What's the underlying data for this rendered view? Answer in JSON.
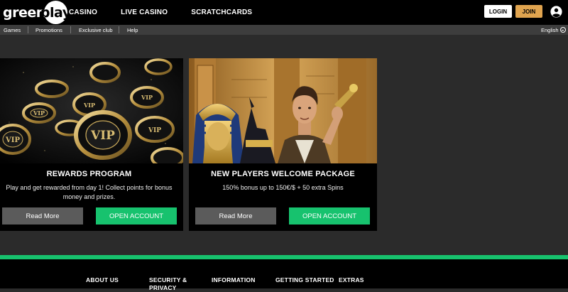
{
  "header": {
    "logo": {
      "text": "green",
      "circle_text": "play"
    },
    "nav": [
      "CASINO",
      "LIVE CASINO",
      "SCRATCHCARDS"
    ],
    "login_label": "LOGIN",
    "join_label": "JOIN",
    "join_color": "#e0a44f"
  },
  "subnav": {
    "items": [
      "Games",
      "Promotions",
      "Exclusive club",
      "Help"
    ],
    "language": "English"
  },
  "cards": [
    {
      "image": "vip-poker-chips",
      "title": "REWARDS PROGRAM",
      "description": "Play and get rewarded from day 1! Collect points for bonus money and prizes.",
      "read_more": "Read More",
      "open_account": "OPEN ACCOUNT"
    },
    {
      "image": "egyptian-adventurer-slot",
      "title": "NEW PLAYERS WELCOME PACKAGE",
      "description": "150% bonus up to 150€/$ + 50 extra Spins",
      "read_more": "Read More",
      "open_account": "OPEN ACCOUNT"
    }
  ],
  "footer": {
    "links": [
      "ABOUT US",
      "SECURITY & PRIVACY",
      "INFORMATION",
      "GETTING STARTED",
      "EXTRAS"
    ]
  },
  "colors": {
    "accent_green": "#17c26e",
    "join_gold": "#e0a44f",
    "background": "#2b2b2b"
  }
}
